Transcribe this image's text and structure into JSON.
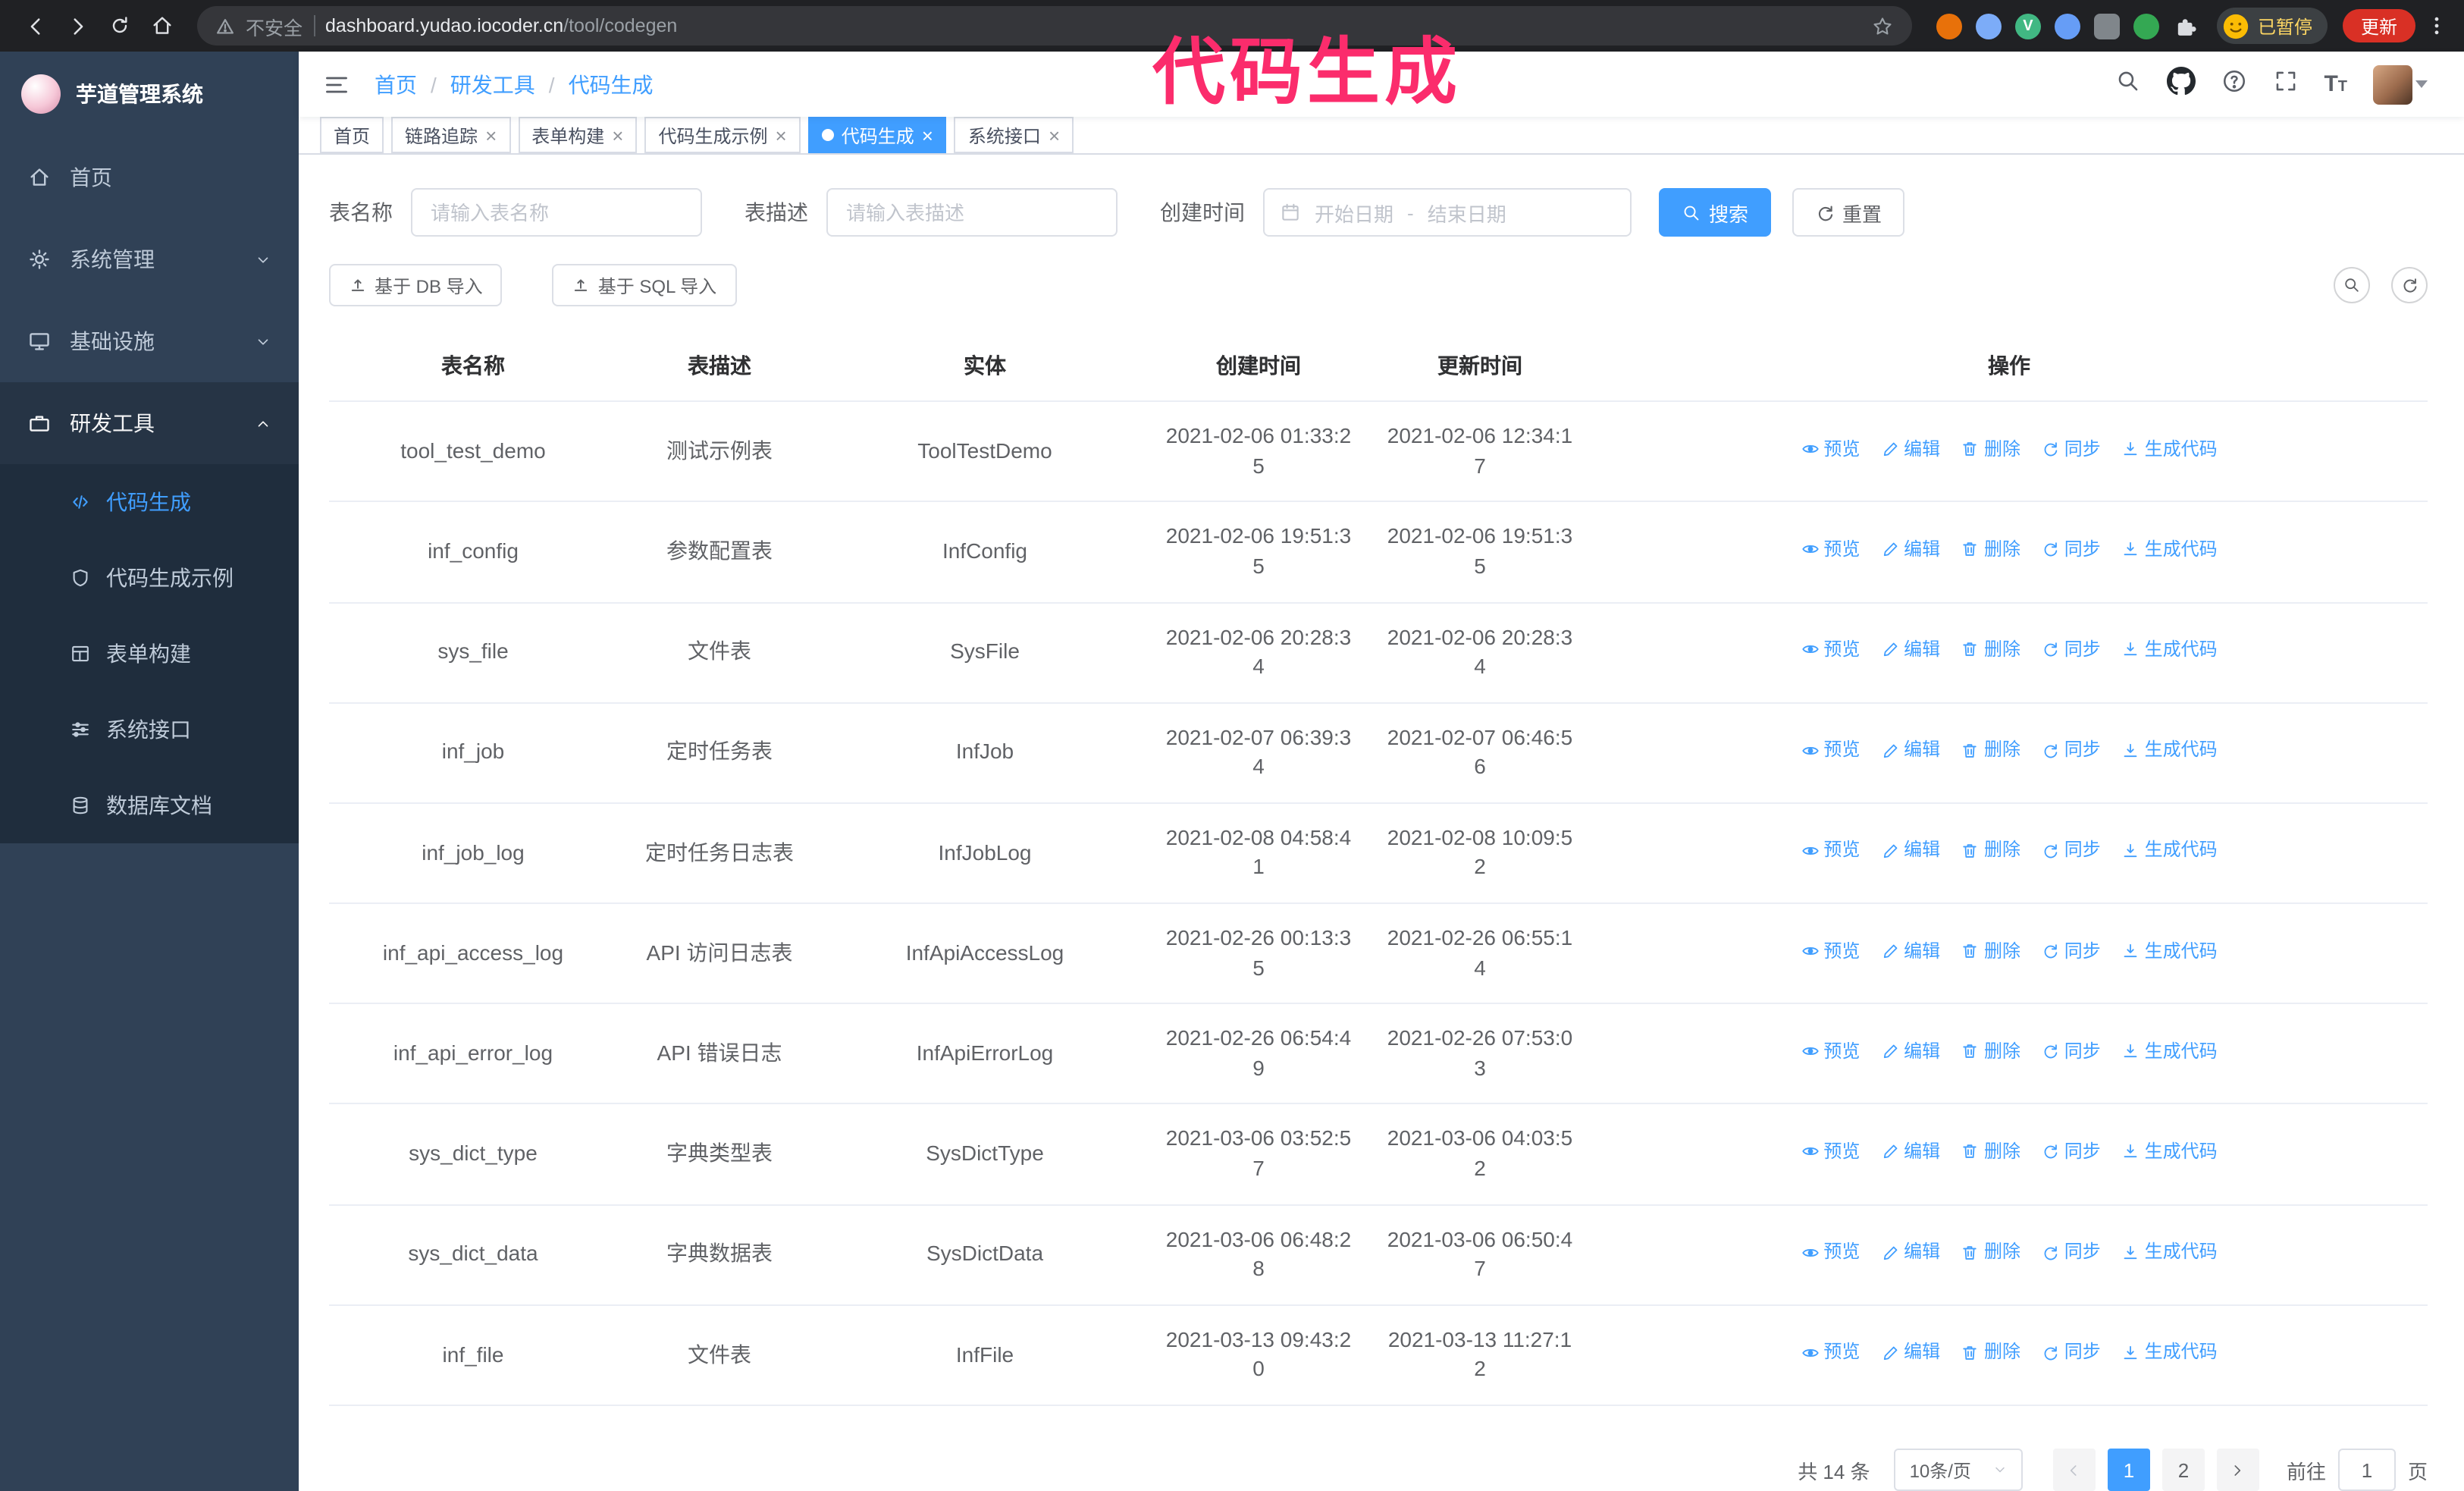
{
  "browser": {
    "security_text": "不安全",
    "url_host": "dashboard.yudao.iocoder.cn",
    "url_path": "/tool/codegen",
    "vue_devtools_letter": "V",
    "profile_status": "已暂停",
    "update_label": "更新"
  },
  "annotation": {
    "text": "代码生成",
    "color": "#fb2c6c"
  },
  "sidebar": {
    "logo_title": "芋道管理系统",
    "items": [
      {
        "label": "首页"
      },
      {
        "label": "系统管理"
      },
      {
        "label": "基础设施"
      },
      {
        "label": "研发工具"
      }
    ],
    "subitems": [
      {
        "label": "代码生成",
        "active": true
      },
      {
        "label": "代码生成示例"
      },
      {
        "label": "表单构建"
      },
      {
        "label": "系统接口"
      },
      {
        "label": "数据库文档"
      }
    ]
  },
  "topbar": {
    "breadcrumb": [
      "首页",
      "研发工具",
      "代码生成"
    ],
    "separator": "/"
  },
  "tabs": [
    {
      "label": "首页"
    },
    {
      "label": "链路追踪"
    },
    {
      "label": "表单构建"
    },
    {
      "label": "代码生成示例"
    },
    {
      "label": "代码生成",
      "active": true
    },
    {
      "label": "系统接口"
    }
  ],
  "filters": {
    "table_name_label": "表名称",
    "table_name_placeholder": "请输入表名称",
    "table_desc_label": "表描述",
    "table_desc_placeholder": "请输入表描述",
    "create_time_label": "创建时间",
    "date_start_placeholder": "开始日期",
    "date_separator": "-",
    "date_end_placeholder": "结束日期",
    "search_label": "搜索",
    "reset_label": "重置"
  },
  "toolbar": {
    "import_db_label": "基于 DB 导入",
    "import_sql_label": "基于 SQL 导入"
  },
  "table": {
    "columns": [
      "表名称",
      "表描述",
      "实体",
      "创建时间",
      "更新时间",
      "操作"
    ],
    "actions": [
      "预览",
      "编辑",
      "删除",
      "同步",
      "生成代码"
    ],
    "rows": [
      {
        "name": "tool_test_demo",
        "desc": "测试示例表",
        "entity": "ToolTestDemo",
        "created": "2021-02-06 01:33:25",
        "updated": "2021-02-06 12:34:17"
      },
      {
        "name": "inf_config",
        "desc": "参数配置表",
        "entity": "InfConfig",
        "created": "2021-02-06 19:51:35",
        "updated": "2021-02-06 19:51:35"
      },
      {
        "name": "sys_file",
        "desc": "文件表",
        "entity": "SysFile",
        "created": "2021-02-06 20:28:34",
        "updated": "2021-02-06 20:28:34"
      },
      {
        "name": "inf_job",
        "desc": "定时任务表",
        "entity": "InfJob",
        "created": "2021-02-07 06:39:34",
        "updated": "2021-02-07 06:46:56"
      },
      {
        "name": "inf_job_log",
        "desc": "定时任务日志表",
        "entity": "InfJobLog",
        "created": "2021-02-08 04:58:41",
        "updated": "2021-02-08 10:09:52"
      },
      {
        "name": "inf_api_access_log",
        "desc": "API 访问日志表",
        "entity": "InfApiAccessLog",
        "created": "2021-02-26 00:13:35",
        "updated": "2021-02-26 06:55:14"
      },
      {
        "name": "inf_api_error_log",
        "desc": "API 错误日志",
        "entity": "InfApiErrorLog",
        "created": "2021-02-26 06:54:49",
        "updated": "2021-02-26 07:53:03"
      },
      {
        "name": "sys_dict_type",
        "desc": "字典类型表",
        "entity": "SysDictType",
        "created": "2021-03-06 03:52:57",
        "updated": "2021-03-06 04:03:52"
      },
      {
        "name": "sys_dict_data",
        "desc": "字典数据表",
        "entity": "SysDictData",
        "created": "2021-03-06 06:48:28",
        "updated": "2021-03-06 06:50:47"
      },
      {
        "name": "inf_file",
        "desc": "文件表",
        "entity": "InfFile",
        "created": "2021-03-13 09:43:20",
        "updated": "2021-03-13 11:27:12"
      }
    ]
  },
  "pagination": {
    "total_label": "共 14 条",
    "page_size_label": "10条/页",
    "pages": [
      "1",
      "2"
    ],
    "goto_label": "前往",
    "goto_value": "1",
    "goto_unit_label": "页"
  },
  "colors": {
    "accent": "#409eff",
    "sidebar_bg": "#304156",
    "submenu_bg": "#1f2d3d",
    "annotation": "#fb2c6c"
  }
}
